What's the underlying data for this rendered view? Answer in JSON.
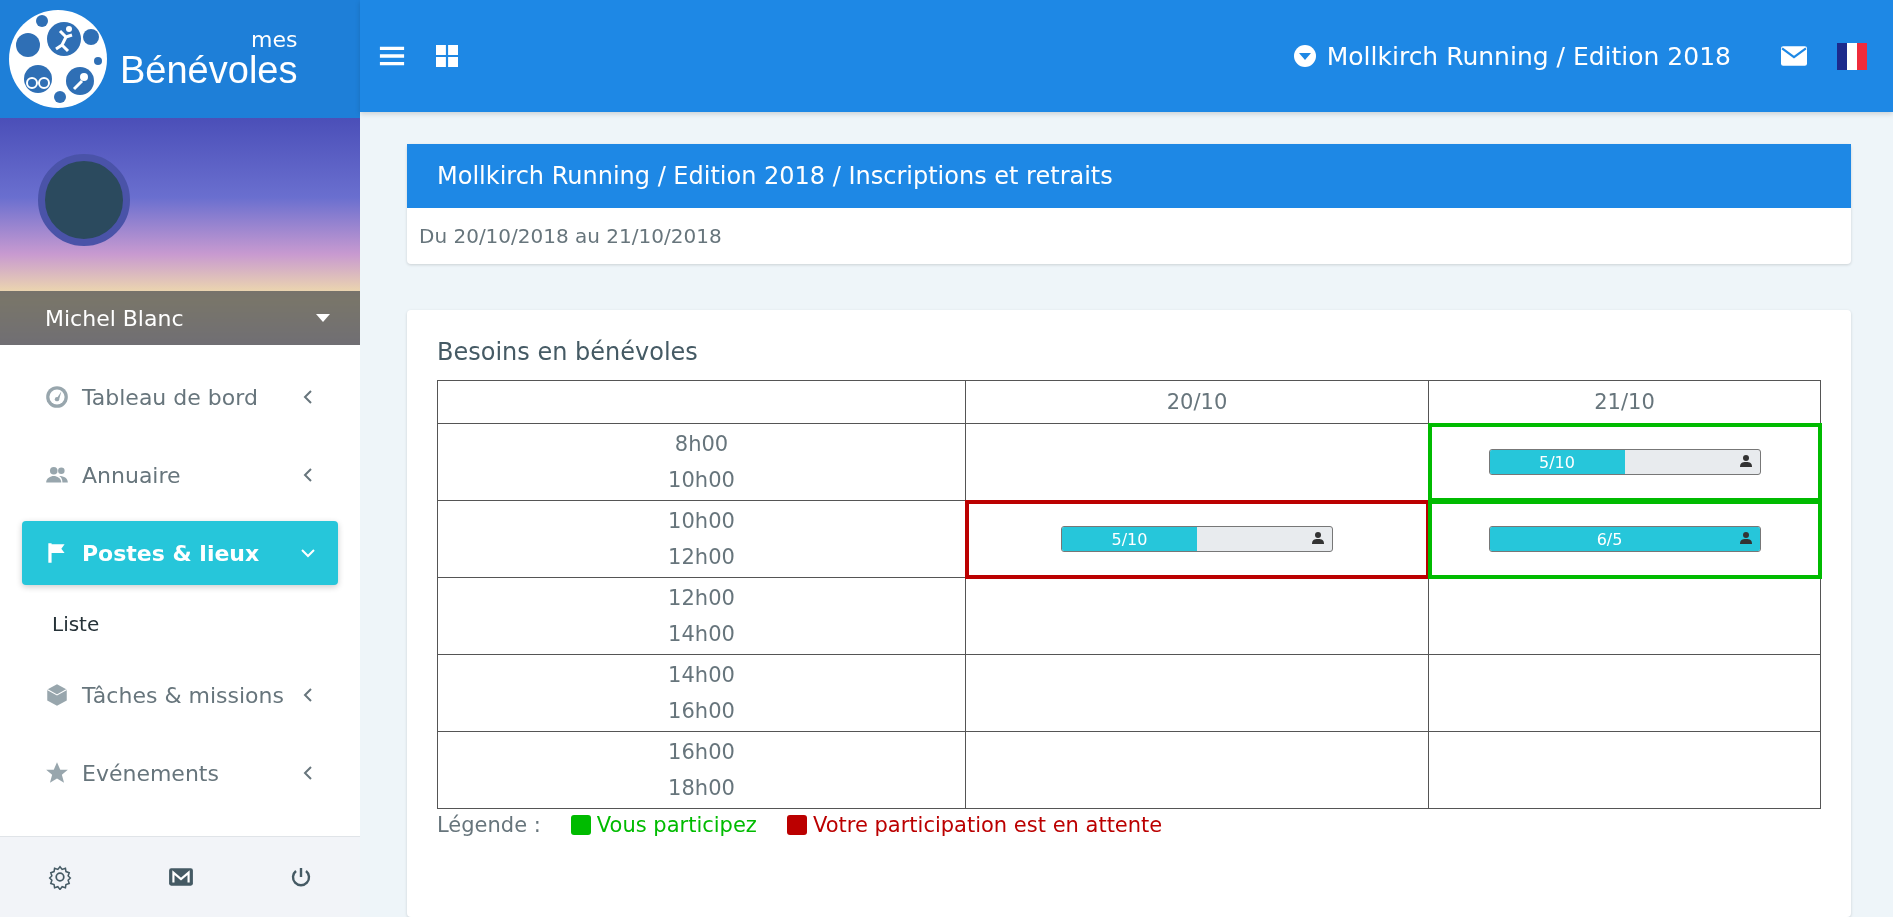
{
  "brand": {
    "small": "mes",
    "name": "Bénévoles"
  },
  "user": {
    "name": "Michel Blanc"
  },
  "nav": [
    {
      "label": "Tableau de bord",
      "selected": false,
      "expanded": false
    },
    {
      "label": "Annuaire",
      "selected": false,
      "expanded": false
    },
    {
      "label": "Postes & lieux",
      "selected": true,
      "expanded": true,
      "children": [
        {
          "label": "Liste"
        }
      ]
    },
    {
      "label": "Tâches & missions",
      "selected": false,
      "expanded": false
    },
    {
      "label": "Evénements",
      "selected": false,
      "expanded": false
    }
  ],
  "topbar": {
    "event": "Mollkirch Running / Edition 2018"
  },
  "page": {
    "title": "Mollkirch Running / Edition 2018 / Inscriptions et retraits",
    "dates": "Du 20/10/2018 au 21/10/2018"
  },
  "needs": {
    "title": "Besoins en bénévoles",
    "columns": [
      "20/10",
      "21/10"
    ],
    "rows": [
      {
        "start": "8h00",
        "end": "10h00",
        "cells": [
          {
            "kind": "empty"
          },
          {
            "kind": "slot",
            "color": "#00bb00",
            "label": "5/10",
            "level": 0.5
          }
        ]
      },
      {
        "start": "10h00",
        "end": "12h00",
        "cells": [
          {
            "kind": "slot",
            "color": "#bb0000",
            "label": "5/10",
            "level": 0.5
          },
          {
            "kind": "slot",
            "color": "#00bb00",
            "label": "6/5",
            "level": 1
          }
        ]
      },
      {
        "start": "12h00",
        "end": "14h00",
        "cells": [
          {
            "kind": "empty"
          },
          {
            "kind": "empty"
          }
        ]
      },
      {
        "start": "14h00",
        "end": "16h00",
        "cells": [
          {
            "kind": "empty"
          },
          {
            "kind": "empty"
          }
        ]
      },
      {
        "start": "16h00",
        "end": "18h00",
        "cells": [
          {
            "kind": "empty"
          },
          {
            "kind": "empty"
          }
        ]
      }
    ],
    "legend": {
      "label": "Légende :",
      "items": [
        {
          "label": "Vous participez",
          "color": "#00bb00"
        },
        {
          "label": "Votre participation est en attente",
          "color": "#bb0000"
        }
      ]
    }
  }
}
